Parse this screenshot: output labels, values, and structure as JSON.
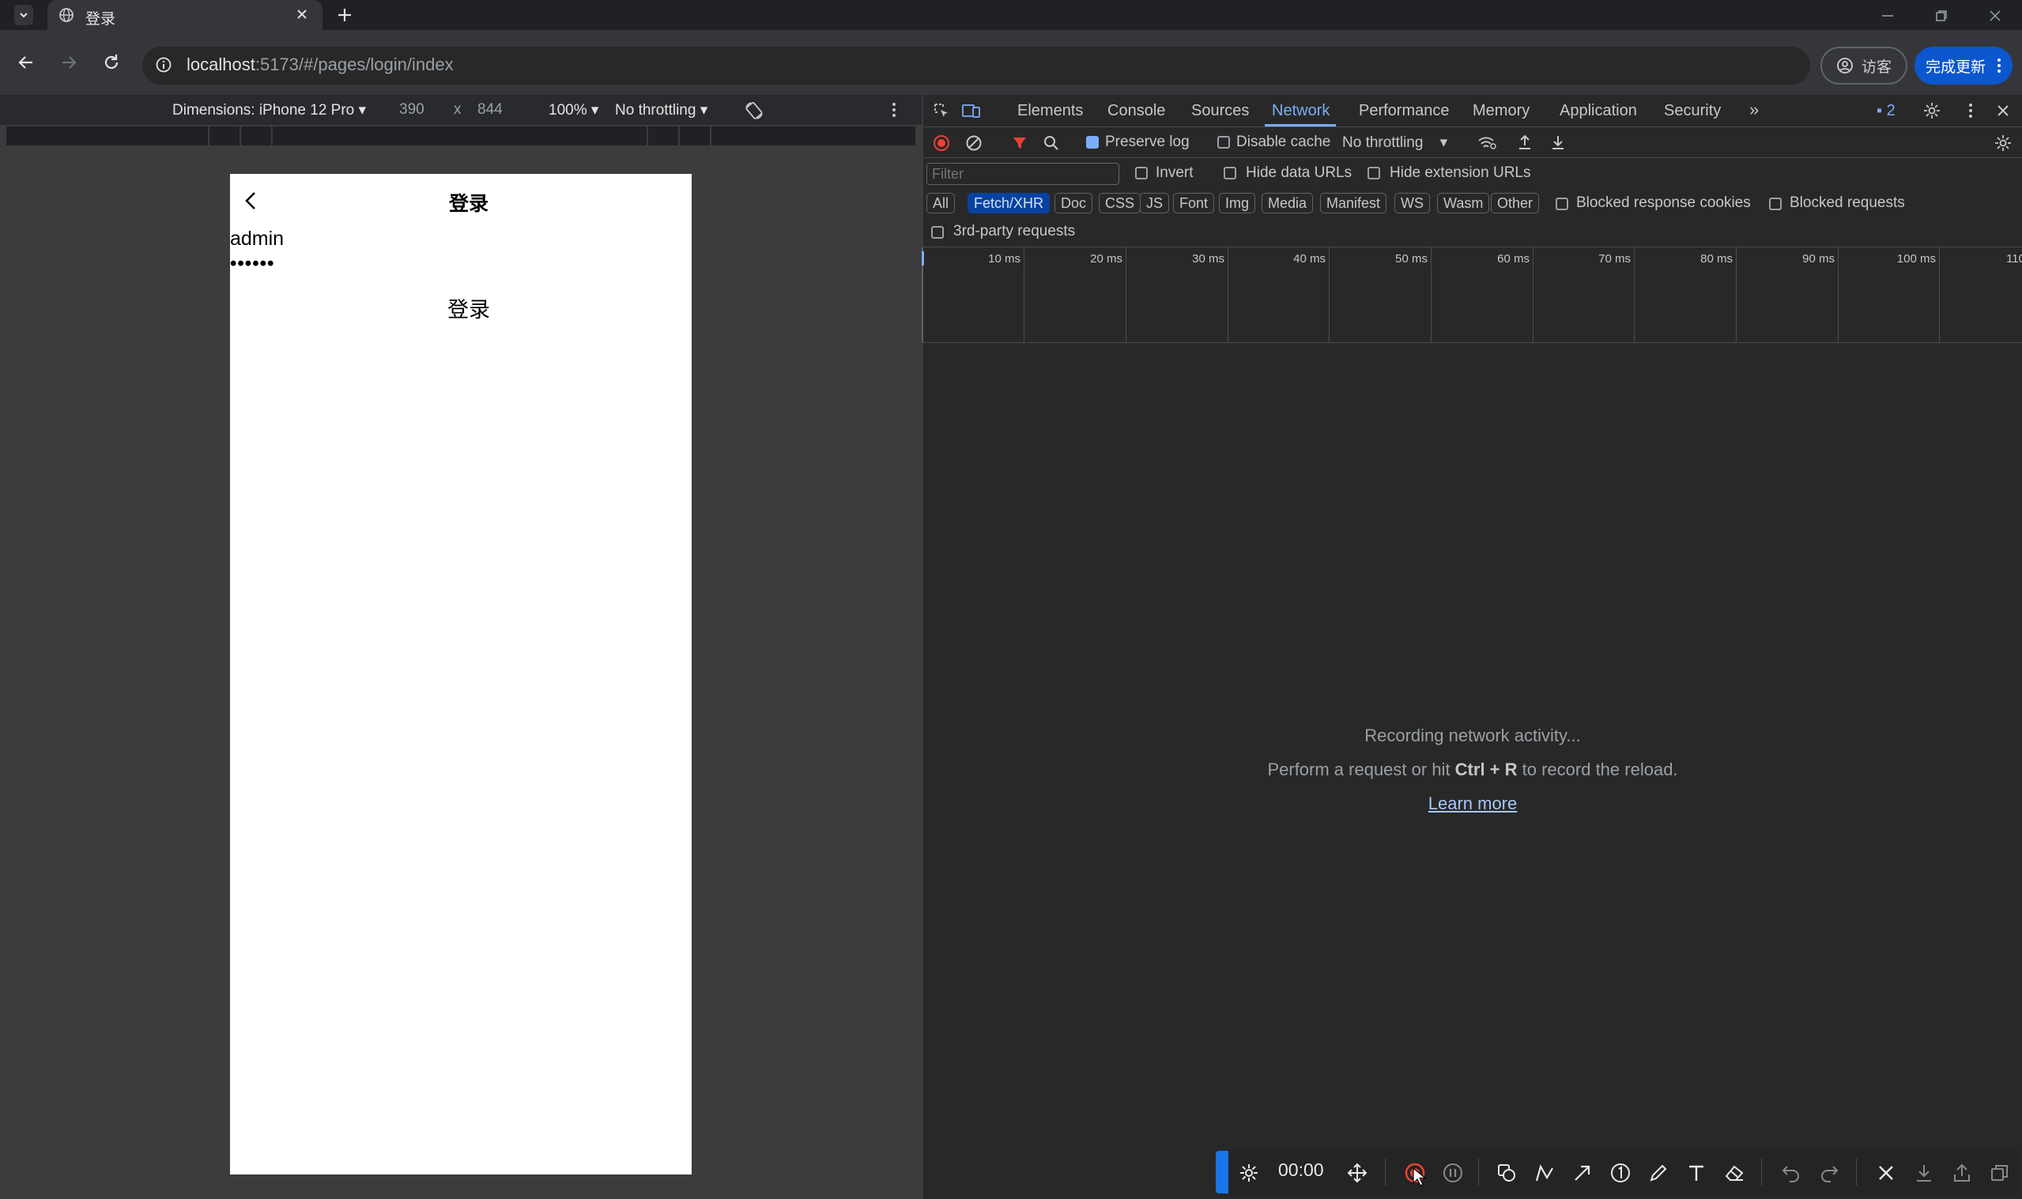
{
  "browser": {
    "tab_title": "登录",
    "url_host": "localhost",
    "url_path": ":5173/#/pages/login/index",
    "guest_label": "访客",
    "update_label": "完成更新"
  },
  "device_toolbar": {
    "dimensions": "Dimensions: iPhone 12 Pro",
    "width": "390",
    "times": "x",
    "height": "844",
    "zoom": "100%",
    "throttle": "No throttling"
  },
  "phone": {
    "title": "登录",
    "username": "admin",
    "password": "••••••",
    "login_button": "登录"
  },
  "devtools": {
    "tabs": [
      "Elements",
      "Console",
      "Sources",
      "Network",
      "Performance",
      "Memory",
      "Application",
      "Security"
    ],
    "more": "»",
    "issues_count": "2",
    "preserve_log": "Preserve log",
    "disable_cache": "Disable cache",
    "throttling": "No throttling",
    "filter_placeholder": "Filter",
    "invert": "Invert",
    "hide_data_urls": "Hide data URLs",
    "hide_ext_urls": "Hide extension URLs",
    "types": [
      "All",
      "Fetch/XHR",
      "Doc",
      "CSS",
      "JS",
      "Font",
      "Img",
      "Media",
      "Manifest",
      "WS",
      "Wasm",
      "Other"
    ],
    "active_type": "Fetch/XHR",
    "blocked_cookies": "Blocked response cookies",
    "blocked_requests": "Blocked requests",
    "third_party": "3rd-party requests",
    "timeline_ticks": [
      "10 ms",
      "20 ms",
      "30 ms",
      "40 ms",
      "50 ms",
      "60 ms",
      "70 ms",
      "80 ms",
      "90 ms",
      "100 ms",
      "110"
    ],
    "empty_title": "Recording network activity...",
    "empty_hint_pre": "Perform a request or hit ",
    "empty_hint_key": "Ctrl + R",
    "empty_hint_post": " to record the reload.",
    "learn_more": "Learn more"
  },
  "annotation_toolbar": {
    "time": "00:00"
  },
  "colors": {
    "accent": "#7cacf8",
    "update_button": "#0b57d0",
    "record_red": "#e94235"
  }
}
